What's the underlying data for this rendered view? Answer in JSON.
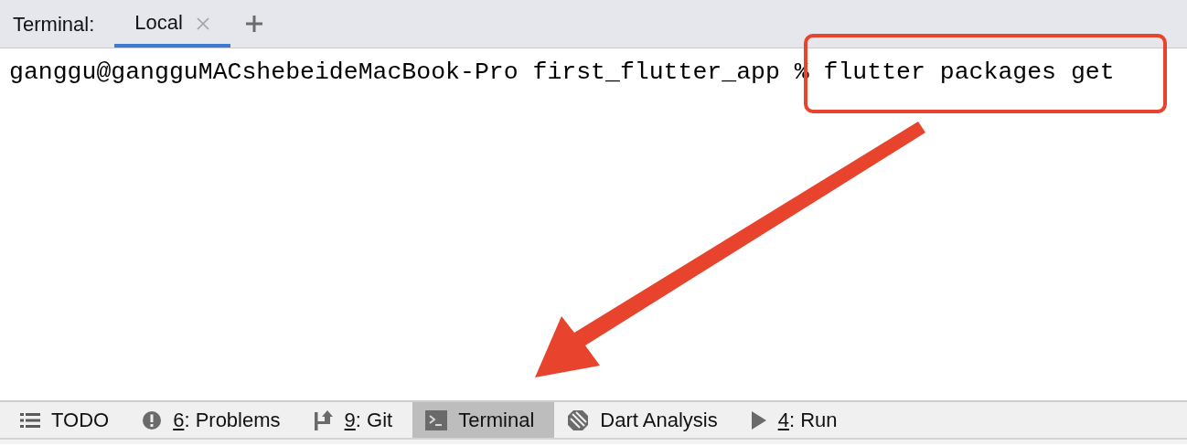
{
  "header": {
    "label": "Terminal:"
  },
  "tabs": [
    {
      "label": "Local",
      "selected": true
    }
  ],
  "terminal": {
    "lines": [
      "ganggu@gangguMACshebeideMacBook-Pro first_flutter_app % flutter packages get"
    ]
  },
  "tool_windows": [
    {
      "kind": "list",
      "label": "TODO",
      "selected": false
    },
    {
      "kind": "problems",
      "mnemonic": "6",
      "label": ": Problems",
      "selected": false
    },
    {
      "kind": "git",
      "mnemonic": "9",
      "label": ": Git",
      "selected": false
    },
    {
      "kind": "terminal",
      "label": "Terminal",
      "selected": true
    },
    {
      "kind": "dart",
      "label": "Dart Analysis",
      "selected": false
    },
    {
      "kind": "run",
      "mnemonic": "4",
      "label": ": Run",
      "selected": false
    }
  ]
}
